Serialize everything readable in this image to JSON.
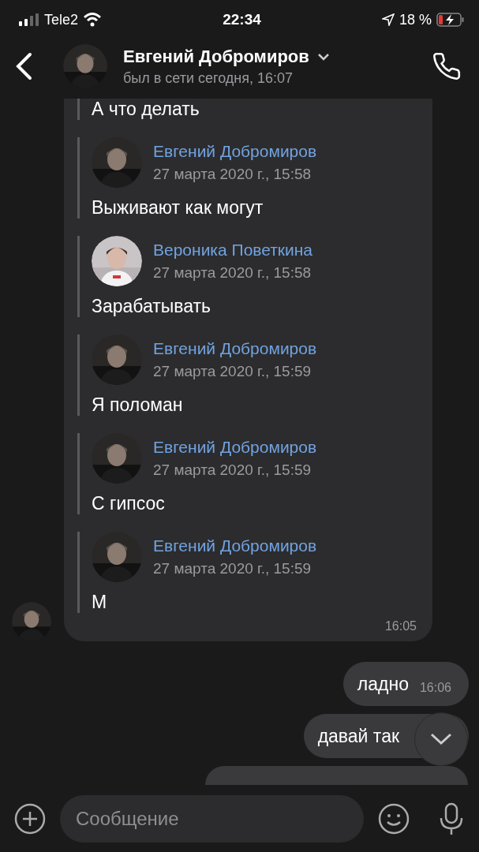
{
  "status_bar": {
    "carrier": "Tele2",
    "time": "22:34",
    "battery": "18 %"
  },
  "header": {
    "name": "Евгений Добромиров",
    "status": "был в сети сегодня, 16:07"
  },
  "messages": [
    {
      "kind": "forwarded",
      "time": "16:05",
      "lead_text": "А что делать",
      "items": [
        {
          "author": "Евгений Добромиров",
          "date": "27 марта 2020 г., 15:58",
          "text": "Выживают как могут",
          "kind": "dark"
        },
        {
          "author": "Вероника Поветкина",
          "date": "27 марта 2020 г., 15:58",
          "text": "Зарабатывать",
          "kind": "light"
        },
        {
          "author": "Евгений Добромиров",
          "date": "27 марта 2020 г., 15:59",
          "text": "Я поломан",
          "kind": "dark"
        },
        {
          "author": "Евгений Добромиров",
          "date": "27 марта 2020 г., 15:59",
          "text": "С гипсос",
          "kind": "dark"
        },
        {
          "author": "Евгений Добромиров",
          "date": "27 марта 2020 г., 15:59",
          "text": "М",
          "kind": "dark"
        }
      ]
    },
    {
      "kind": "outgoing",
      "text": "ладно",
      "time": "16:06"
    },
    {
      "kind": "outgoing",
      "text": "давай так"
    },
    {
      "kind": "cut"
    }
  ],
  "composer": {
    "placeholder": "Сообщение"
  }
}
